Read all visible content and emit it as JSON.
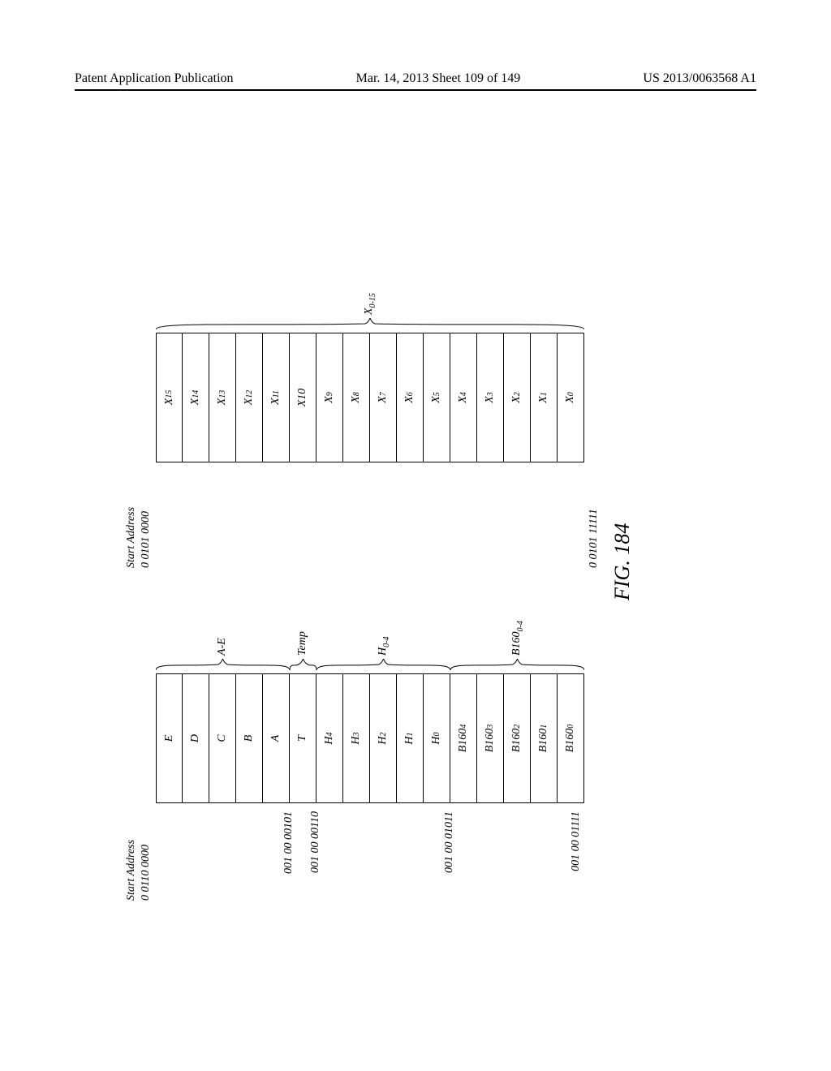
{
  "header": {
    "left": "Patent Application Publication",
    "center": "Mar. 14, 2013  Sheet 109 of 149",
    "right": "US 2013/0063568 A1"
  },
  "figure_label": "FIG. 184",
  "left_stack": {
    "title": "Start Address",
    "top_addr": "0 0110 0000",
    "addrs": {
      "row5_A": "001 00 00101",
      "row6_T": "001 00 00110",
      "row11_B1604": "001 00 01011",
      "row15_B1600": "001 00 01111"
    },
    "rows": [
      "E",
      "D",
      "C",
      "B",
      "A",
      "T",
      "H4",
      "H3",
      "H2",
      "H1",
      "H0",
      "B1604",
      "B1603",
      "B1602",
      "B1601",
      "B1600"
    ],
    "rows_fmt": [
      {
        "t": "E"
      },
      {
        "t": "D"
      },
      {
        "t": "C"
      },
      {
        "t": "B"
      },
      {
        "t": "A"
      },
      {
        "t": "T"
      },
      {
        "t": "H",
        "s": "4"
      },
      {
        "t": "H",
        "s": "3"
      },
      {
        "t": "H",
        "s": "2"
      },
      {
        "t": "H",
        "s": "1"
      },
      {
        "t": "H",
        "s": "0"
      },
      {
        "t": "B160",
        "s": "4"
      },
      {
        "t": "B160",
        "s": "3"
      },
      {
        "t": "B160",
        "s": "2"
      },
      {
        "t": "B160",
        "s": "1"
      },
      {
        "t": "B160",
        "s": "0"
      }
    ],
    "groups": [
      {
        "label": "A-E",
        "from": 0,
        "to": 4
      },
      {
        "label": "Temp",
        "from": 5,
        "to": 5
      },
      {
        "label": "H",
        "sub": "0-4",
        "from": 6,
        "to": 10
      },
      {
        "label": "B160",
        "sub": "0-4",
        "from": 11,
        "to": 15
      }
    ]
  },
  "right_stack": {
    "title": "Start Address",
    "top_addr": "0 0101 0000",
    "bottom_addr": "0 0101 11111",
    "rows_fmt": [
      {
        "t": "X",
        "s": "15"
      },
      {
        "t": "X",
        "s": "14"
      },
      {
        "t": "X",
        "s": "13"
      },
      {
        "t": "X",
        "s": "12"
      },
      {
        "t": "X",
        "s": "11"
      },
      {
        "t": "X10"
      },
      {
        "t": "X",
        "s": "9"
      },
      {
        "t": "X",
        "s": "8"
      },
      {
        "t": "X",
        "s": "7"
      },
      {
        "t": "X",
        "s": "6"
      },
      {
        "t": "X",
        "s": "5"
      },
      {
        "t": "X",
        "s": "4"
      },
      {
        "t": "X",
        "s": "3"
      },
      {
        "t": "X",
        "s": "2"
      },
      {
        "t": "X",
        "s": "1"
      },
      {
        "t": "X",
        "s": "0"
      }
    ],
    "group": {
      "label": "X",
      "sub": "0-15",
      "from": 0,
      "to": 15
    }
  }
}
